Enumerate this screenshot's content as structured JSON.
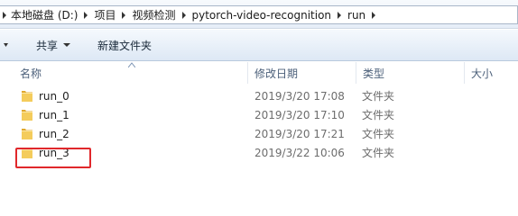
{
  "address": {
    "crumbs": [
      "本地磁盘 (D:)",
      "项目",
      "视频检测",
      "pytorch-video-recognition",
      "run"
    ]
  },
  "toolbar": {
    "share_label": "共享",
    "new_folder_label": "新建文件夹"
  },
  "columns": {
    "name": "名称",
    "date": "修改日期",
    "type": "类型",
    "size": "大小"
  },
  "files": [
    {
      "name": "run_0",
      "date": "2019/3/20 17:08",
      "type": "文件夹",
      "icon": "folder-icon"
    },
    {
      "name": "run_1",
      "date": "2019/3/20 17:10",
      "type": "文件夹",
      "icon": "folder-icon"
    },
    {
      "name": "run_2",
      "date": "2019/3/20 17:21",
      "type": "文件夹",
      "icon": "folder-icon"
    },
    {
      "name": "run_3",
      "date": "2019/3/22 10:06",
      "type": "文件夹",
      "icon": "folder-icon"
    }
  ],
  "colors": {
    "highlight_box": "#e0282b",
    "folder": "#f2c453"
  }
}
